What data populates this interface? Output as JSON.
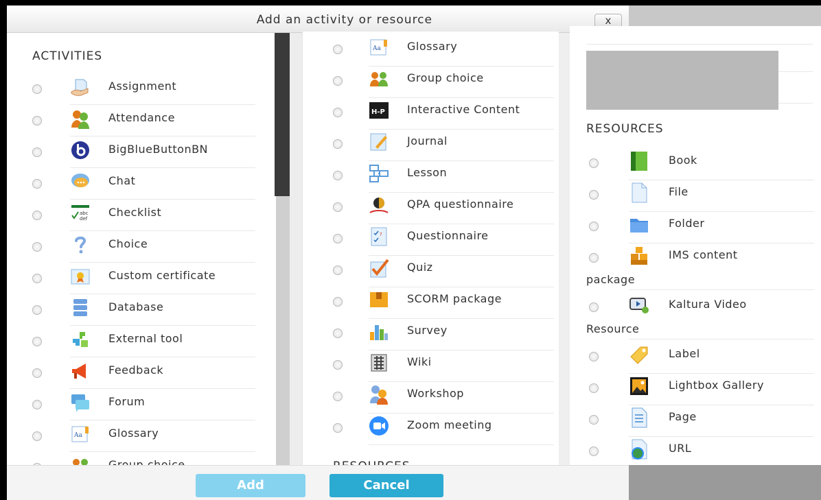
{
  "dialog": {
    "title": "Add an activity or resource",
    "close_label": "x"
  },
  "activities": {
    "title": "ACTIVITIES",
    "items": [
      {
        "label": "Assignment",
        "icon": "assignment-icon"
      },
      {
        "label": "Attendance",
        "icon": "attendance-icon"
      },
      {
        "label": "BigBlueButtonBN",
        "icon": "bigbluebutton-icon"
      },
      {
        "label": "Chat",
        "icon": "chat-icon"
      },
      {
        "label": "Checklist",
        "icon": "checklist-icon"
      },
      {
        "label": "Choice",
        "icon": "choice-icon"
      },
      {
        "label": "Custom certificate",
        "icon": "certificate-icon"
      },
      {
        "label": "Database",
        "icon": "database-icon"
      },
      {
        "label": "External tool",
        "icon": "external-tool-icon"
      },
      {
        "label": "Feedback",
        "icon": "feedback-icon"
      },
      {
        "label": "Forum",
        "icon": "forum-icon"
      },
      {
        "label": "Glossary",
        "icon": "glossary-icon"
      },
      {
        "label": "Group choice",
        "icon": "group-choice-icon"
      }
    ]
  },
  "activities_scrolled": {
    "items": [
      {
        "label": "Glossary",
        "icon": "glossary-icon"
      },
      {
        "label": "Group choice",
        "icon": "group-choice-icon"
      },
      {
        "label": "Interactive Content",
        "icon": "h5p-icon",
        "icon_text": "H-P"
      },
      {
        "label": "Journal",
        "icon": "journal-icon"
      },
      {
        "label": "Lesson",
        "icon": "lesson-icon"
      },
      {
        "label": "QPA questionnaire",
        "icon": "qpa-icon"
      },
      {
        "label": "Questionnaire",
        "icon": "questionnaire-icon"
      },
      {
        "label": "Quiz",
        "icon": "quiz-icon"
      },
      {
        "label": "SCORM package",
        "icon": "scorm-icon"
      },
      {
        "label": "Survey",
        "icon": "survey-icon"
      },
      {
        "label": "Wiki",
        "icon": "wiki-icon"
      },
      {
        "label": "Workshop",
        "icon": "workshop-icon"
      },
      {
        "label": "Zoom meeting",
        "icon": "zoom-icon"
      }
    ],
    "resources_title_partial": "RESOURCES"
  },
  "resources": {
    "title": "RESOURCES",
    "items": [
      {
        "label": "Book",
        "icon": "book-icon"
      },
      {
        "label": "File",
        "icon": "file-icon"
      },
      {
        "label": "Folder",
        "icon": "folder-icon"
      },
      {
        "label": "IMS content",
        "label_line2": "package",
        "icon": "ims-icon"
      },
      {
        "label": "Kaltura Video",
        "label_line2": "Resource",
        "icon": "kaltura-icon"
      },
      {
        "label": "Label",
        "icon": "label-icon"
      },
      {
        "label": "Lightbox Gallery",
        "icon": "lightbox-icon"
      },
      {
        "label": "Page",
        "icon": "page-icon"
      },
      {
        "label": "URL",
        "icon": "url-icon"
      }
    ]
  },
  "footer": {
    "add_label": "Add",
    "cancel_label": "Cancel"
  }
}
